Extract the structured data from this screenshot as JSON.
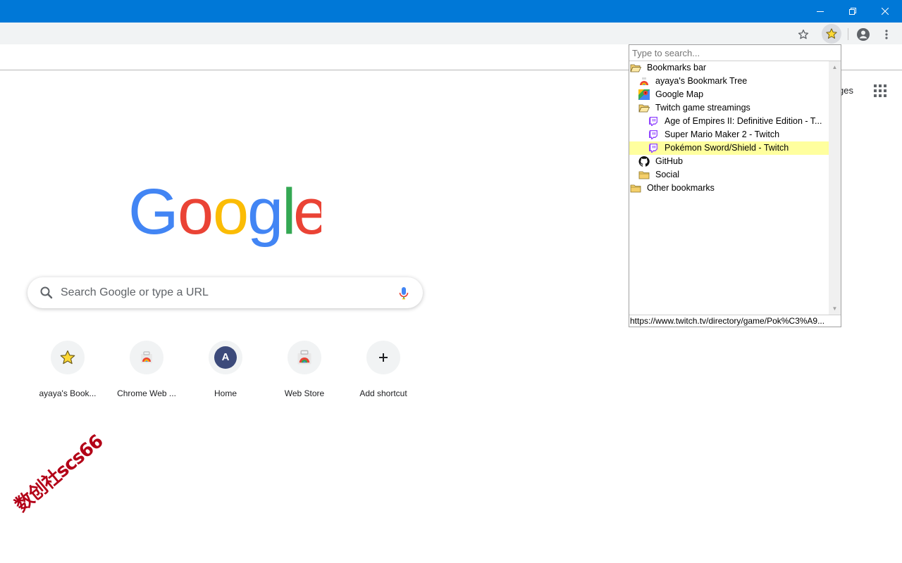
{
  "window": {
    "minimize": "minimize",
    "restore": "restore",
    "close": "close"
  },
  "popup": {
    "search_placeholder": "Type to search...",
    "status_url": "https://www.twitch.tv/directory/game/Pok%C3%A9...",
    "tree": [
      {
        "label": "Bookmarks bar",
        "icon": "folder-open-icon",
        "depth": 0
      },
      {
        "label": "ayaya's Bookmark Tree",
        "icon": "rainbow-icon",
        "depth": 1
      },
      {
        "label": "Google Map",
        "icon": "google-maps-icon",
        "depth": 1
      },
      {
        "label": "Twitch game streamings",
        "icon": "folder-open-icon",
        "depth": 1
      },
      {
        "label": "Age of Empires II: Definitive Edition - T...",
        "icon": "twitch-icon",
        "depth": 2
      },
      {
        "label": "Super Mario Maker 2 - Twitch",
        "icon": "twitch-icon",
        "depth": 2
      },
      {
        "label": "Pokémon Sword/Shield - Twitch",
        "icon": "twitch-icon",
        "depth": 2,
        "selected": true
      },
      {
        "label": "GitHub",
        "icon": "github-icon",
        "depth": 1
      },
      {
        "label": "Social",
        "icon": "folder-icon",
        "depth": 1
      },
      {
        "label": "Other bookmarks",
        "icon": "folder-icon",
        "depth": 0
      }
    ]
  },
  "ntp": {
    "search_placeholder": "Search Google or type a URL",
    "images_link": "ges",
    "shortcuts": [
      {
        "label": "ayaya's Book...",
        "icon": "star-icon"
      },
      {
        "label": "Chrome Web ...",
        "icon": "chrome-store-icon"
      },
      {
        "label": "Home",
        "icon": "avatar-letter",
        "letter": "A"
      },
      {
        "label": "Web Store",
        "icon": "web-store-icon"
      },
      {
        "label": "Add shortcut",
        "icon": "plus-icon"
      }
    ]
  },
  "watermark": "数创社scs66",
  "colors": {
    "titlebar": "#0078d7",
    "selected_row": "#ffff9e",
    "twitch": "#9146ff",
    "avatar": "#3c4a7a"
  }
}
